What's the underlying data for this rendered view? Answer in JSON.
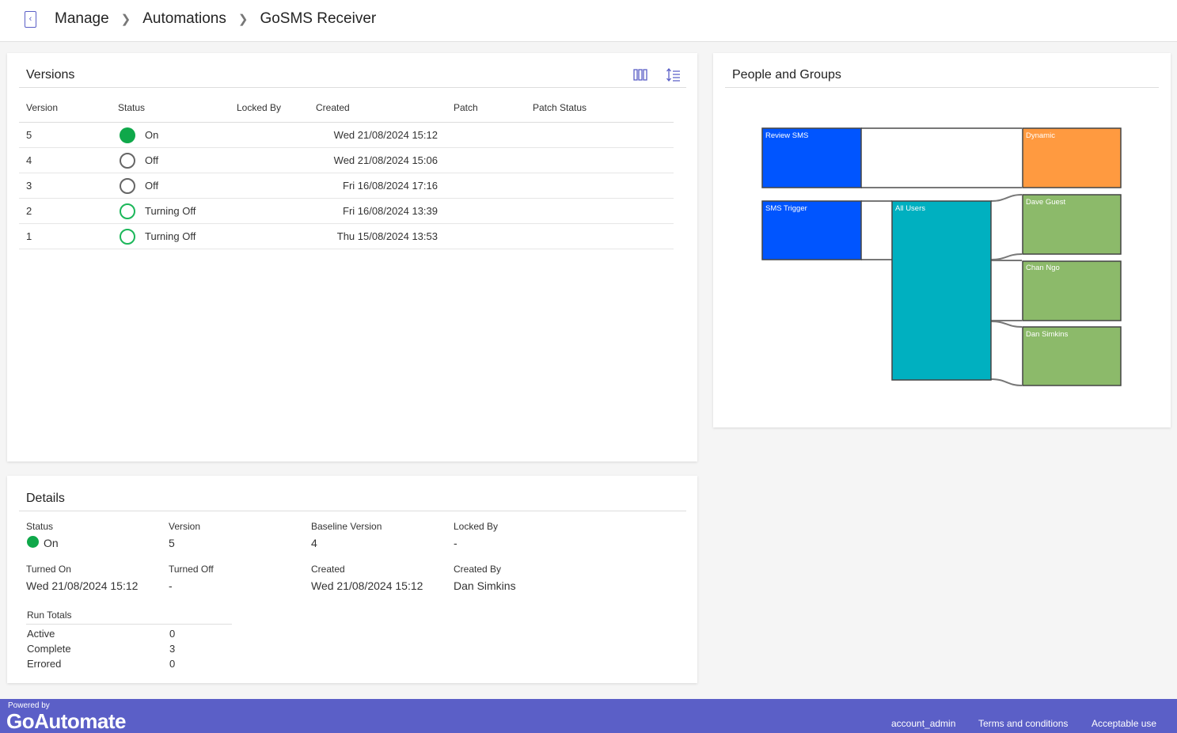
{
  "breadcrumb": {
    "items": [
      "Manage",
      "Automations",
      "GoSMS Receiver"
    ]
  },
  "icons": {
    "back": "chevron-left-icon",
    "columns": "columns-icon",
    "sort": "sort-icon"
  },
  "colors": {
    "accent": "#5b5fc7",
    "status_on": "#0fa84a",
    "flow_blue": "#0055ff",
    "flow_teal": "#00b0c0",
    "flow_orange": "#ff9a40",
    "flow_green": "#8cba6a"
  },
  "versions": {
    "title": "Versions",
    "columns": [
      "Version",
      "Status",
      "Locked By",
      "Created",
      "Patch",
      "Patch Status"
    ],
    "rows": [
      {
        "version": "5",
        "status": "On",
        "locked_by": "",
        "created": "Wed 21/08/2024 15:12",
        "patch": "",
        "patch_status": ""
      },
      {
        "version": "4",
        "status": "Off",
        "locked_by": "",
        "created": "Wed 21/08/2024 15:06",
        "patch": "",
        "patch_status": ""
      },
      {
        "version": "3",
        "status": "Off",
        "locked_by": "",
        "created": "Fri 16/08/2024 17:16",
        "patch": "",
        "patch_status": ""
      },
      {
        "version": "2",
        "status": "Turning Off",
        "locked_by": "",
        "created": "Fri 16/08/2024 13:39",
        "patch": "",
        "patch_status": ""
      },
      {
        "version": "1",
        "status": "Turning Off",
        "locked_by": "",
        "created": "Thu 15/08/2024 13:53",
        "patch": "",
        "patch_status": ""
      }
    ]
  },
  "people": {
    "title": "People and Groups",
    "nodes": [
      "Review SMS",
      "Dynamic",
      "SMS Trigger",
      "All Users",
      "Dave Guest",
      "Chan Ngo",
      "Dan Simkins"
    ]
  },
  "details": {
    "title": "Details",
    "status_label": "Status",
    "status_value": "On",
    "version_label": "Version",
    "version_value": "5",
    "baseline_label": "Baseline Version",
    "baseline_value": "4",
    "locked_label": "Locked By",
    "locked_value": "-",
    "turned_on_label": "Turned On",
    "turned_on_value": "Wed 21/08/2024 15:12",
    "turned_off_label": "Turned Off",
    "turned_off_value": "-",
    "created_label": "Created",
    "created_value": "Wed 21/08/2024 15:12",
    "created_by_label": "Created By",
    "created_by_value": "Dan Simkins",
    "run_totals_label": "Run Totals",
    "run_totals": [
      {
        "label": "Active",
        "value": "0"
      },
      {
        "label": "Complete",
        "value": "3"
      },
      {
        "label": "Errored",
        "value": "0"
      }
    ]
  },
  "footer": {
    "powered_by": "Powered by",
    "brand": "GoAutomate",
    "links": [
      "account_admin",
      "Terms and conditions",
      "Acceptable use"
    ]
  }
}
